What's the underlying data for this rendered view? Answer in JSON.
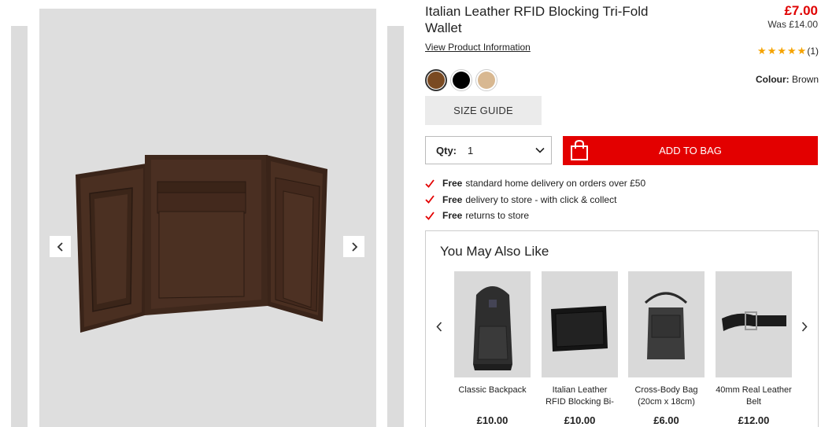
{
  "product": {
    "title": "Italian Leather RFID Blocking Tri-Fold Wallet",
    "price": "£7.00",
    "was_price": "Was £14.00",
    "view_info": "View Product Information",
    "rating_count": "(1)",
    "rating_stars": 5,
    "colour_label": "Colour:",
    "colour_value": "Brown",
    "swatches": [
      "#7a4a22",
      "#000000",
      "#d8b891"
    ]
  },
  "actions": {
    "size_guide": "SIZE GUIDE",
    "qty_label": "Qty:",
    "qty_value": "1",
    "add_to_bag": "ADD TO BAG"
  },
  "delivery": [
    {
      "bold": "Free",
      "text": "standard home delivery on orders over £50"
    },
    {
      "bold": "Free",
      "text": "delivery to store - with click & collect"
    },
    {
      "bold": "Free",
      "text": "returns to store"
    }
  ],
  "ymal": {
    "title": "You May Also Like",
    "items": [
      {
        "name": "Classic Backpack",
        "price": "£10.00"
      },
      {
        "name": "Italian Leather RFID Blocking Bi-",
        "price": "£10.00"
      },
      {
        "name": "Cross-Body Bag (20cm x 18cm)",
        "price": "£6.00"
      },
      {
        "name": "40mm Real Leather Belt",
        "price": "£12.00"
      }
    ]
  },
  "colors": {
    "accent_red": "#e30000",
    "star": "#f5a300"
  }
}
